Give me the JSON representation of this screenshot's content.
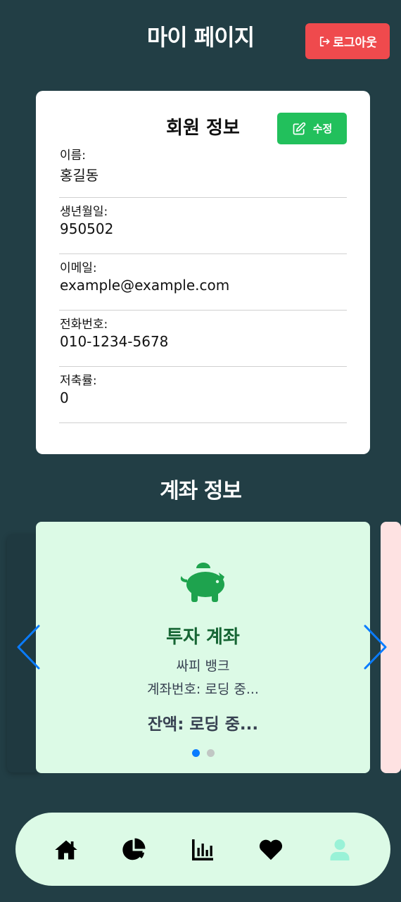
{
  "header": {
    "title": "마이 페이지",
    "logout_label": "로그아웃"
  },
  "member_info": {
    "title": "회원 정보",
    "edit_label": "수정",
    "fields": [
      {
        "label": "이름:",
        "value": "홍길동"
      },
      {
        "label": "생년월일:",
        "value": "950502"
      },
      {
        "label": "이메일:",
        "value": "example@example.com"
      },
      {
        "label": "전화번호:",
        "value": "010-1234-5678"
      },
      {
        "label": "저축률:",
        "value": "0"
      }
    ]
  },
  "accounts": {
    "title": "계좌 정보",
    "current": {
      "icon": "piggy-bank-icon",
      "name": "투자 계좌",
      "bank": "싸피 뱅크",
      "number_text": "계좌번호: 로딩 중...",
      "balance_text": "잔액: 로딩 중..."
    },
    "page_count": 2,
    "active_page": 1
  },
  "bottom_nav": {
    "items": [
      {
        "icon": "home-icon"
      },
      {
        "icon": "pie-chart-icon"
      },
      {
        "icon": "bar-chart-icon"
      },
      {
        "icon": "heart-icon"
      },
      {
        "icon": "user-icon",
        "active": true
      }
    ]
  },
  "colors": {
    "background": "#223e45",
    "logout": "#ef4a4d",
    "edit": "#22c05c",
    "account_card": "#dcfae6",
    "account_title": "#166534",
    "next_card": "#fee2e2",
    "arrow": "#0a7cff",
    "active_nav": "#99f2d7"
  }
}
